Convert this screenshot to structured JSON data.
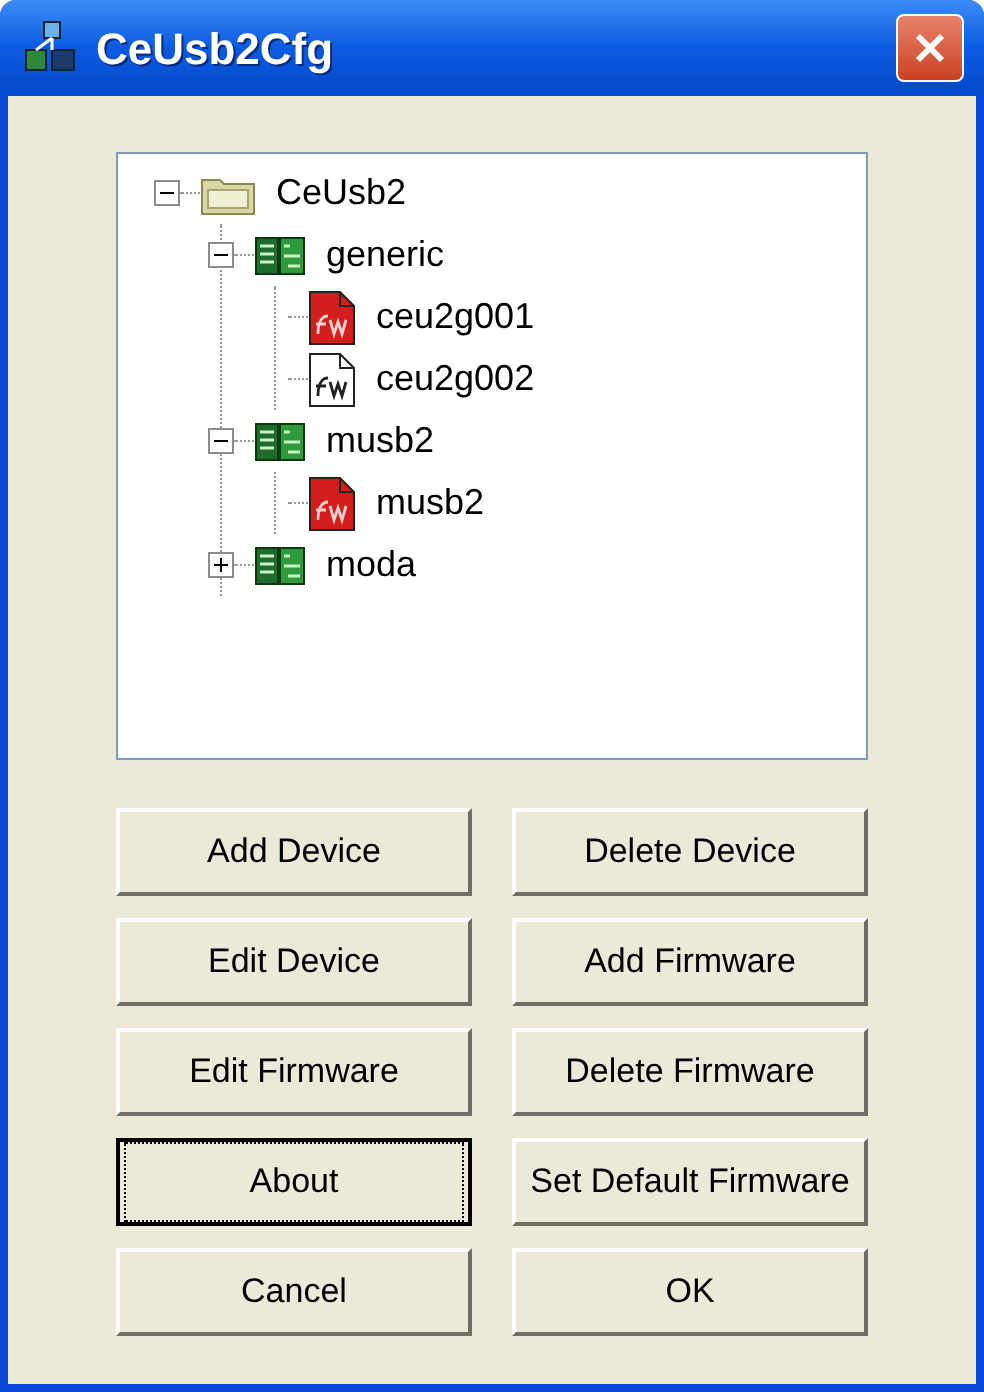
{
  "window": {
    "title": "CeUsb2Cfg"
  },
  "tree": [
    {
      "label": "CeUsb2",
      "kind": "folder",
      "expanded": true,
      "children": [
        {
          "label": "generic",
          "kind": "device",
          "expanded": true,
          "children": [
            {
              "label": "ceu2g001",
              "kind": "firmware",
              "default": true
            },
            {
              "label": "ceu2g002",
              "kind": "firmware",
              "default": false
            }
          ]
        },
        {
          "label": "musb2",
          "kind": "device",
          "expanded": true,
          "children": [
            {
              "label": "musb2",
              "kind": "firmware",
              "default": true
            }
          ]
        },
        {
          "label": "moda",
          "kind": "device",
          "expanded": false
        }
      ]
    }
  ],
  "buttons": [
    {
      "label": "Add Device",
      "focused": false
    },
    {
      "label": "Delete Device",
      "focused": false
    },
    {
      "label": "Edit Device",
      "focused": false
    },
    {
      "label": "Add Firmware",
      "focused": false
    },
    {
      "label": "Edit Firmware",
      "focused": false
    },
    {
      "label": "Delete Firmware",
      "focused": false
    },
    {
      "label": "About",
      "focused": true
    },
    {
      "label": "Set Default Firmware",
      "focused": false
    },
    {
      "label": "Cancel",
      "focused": false
    },
    {
      "label": "OK",
      "focused": false
    }
  ]
}
